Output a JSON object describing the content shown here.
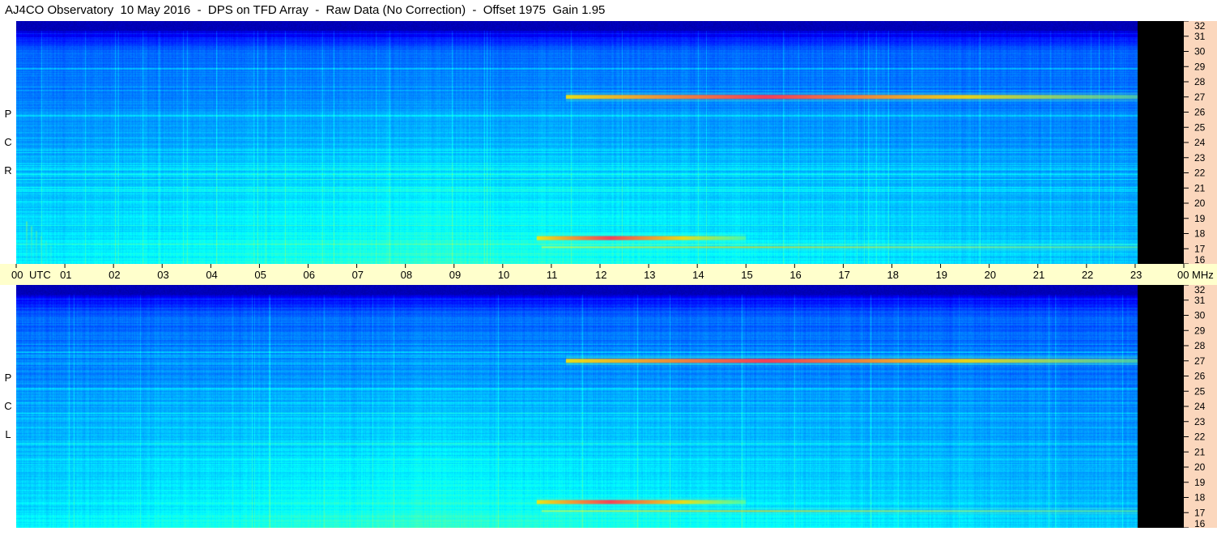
{
  "title": "AJ4CO Observatory  10 May 2016  -  DPS on TFD Array  -  Raw Data (No Correction)  -  Offset 1975  Gain 1.95",
  "panels": {
    "top": {
      "label": "R C P"
    },
    "bottom": {
      "label": "L C P"
    }
  },
  "colors": {
    "background_band": "#0000ff",
    "freq_axis_bg": "#fbd7bd",
    "time_axis_bg": "#ffffcc",
    "no_data": "#000000"
  },
  "chart_data": {
    "type": "heatmap",
    "title": "AJ4CO Observatory  10 May 2016  -  DPS on TFD Array  -  Raw Data (No Correction)  -  Offset 1975  Gain 1.95",
    "x": {
      "unit": "UTC",
      "ticks": [
        "00",
        "01",
        "02",
        "03",
        "04",
        "05",
        "06",
        "07",
        "08",
        "09",
        "10",
        "11",
        "12",
        "13",
        "14",
        "15",
        "16",
        "17",
        "18",
        "19",
        "20",
        "21",
        "22",
        "23",
        "00"
      ],
      "range": [
        0,
        24
      ],
      "data_ends_hour": 23.05
    },
    "y": {
      "unit": "MHz",
      "ticks": [
        "16",
        "17",
        "18",
        "19",
        "20",
        "21",
        "22",
        "23",
        "24",
        "25",
        "26",
        "27",
        "28",
        "29",
        "30",
        "31",
        "32"
      ],
      "range": [
        16,
        32
      ]
    },
    "series": [
      {
        "name": "R C P"
      },
      {
        "name": "L C P"
      }
    ],
    "features": [
      {
        "freq_mhz": 27.0,
        "from_hour": 11.3,
        "to_hour": 23.05,
        "intensity": "high"
      },
      {
        "freq_mhz": 17.7,
        "from_hour": 10.7,
        "to_hour": 15.0,
        "intensity": "high"
      },
      {
        "freq_mhz": 17.1,
        "from_hour": 10.8,
        "to_hour": 23.05,
        "intensity": "medium"
      },
      {
        "freq_mhz": 18.8,
        "from_hour": 0.2,
        "to_hour": 0.8,
        "intensity": "burst"
      }
    ],
    "grid": false,
    "legend": "none"
  }
}
